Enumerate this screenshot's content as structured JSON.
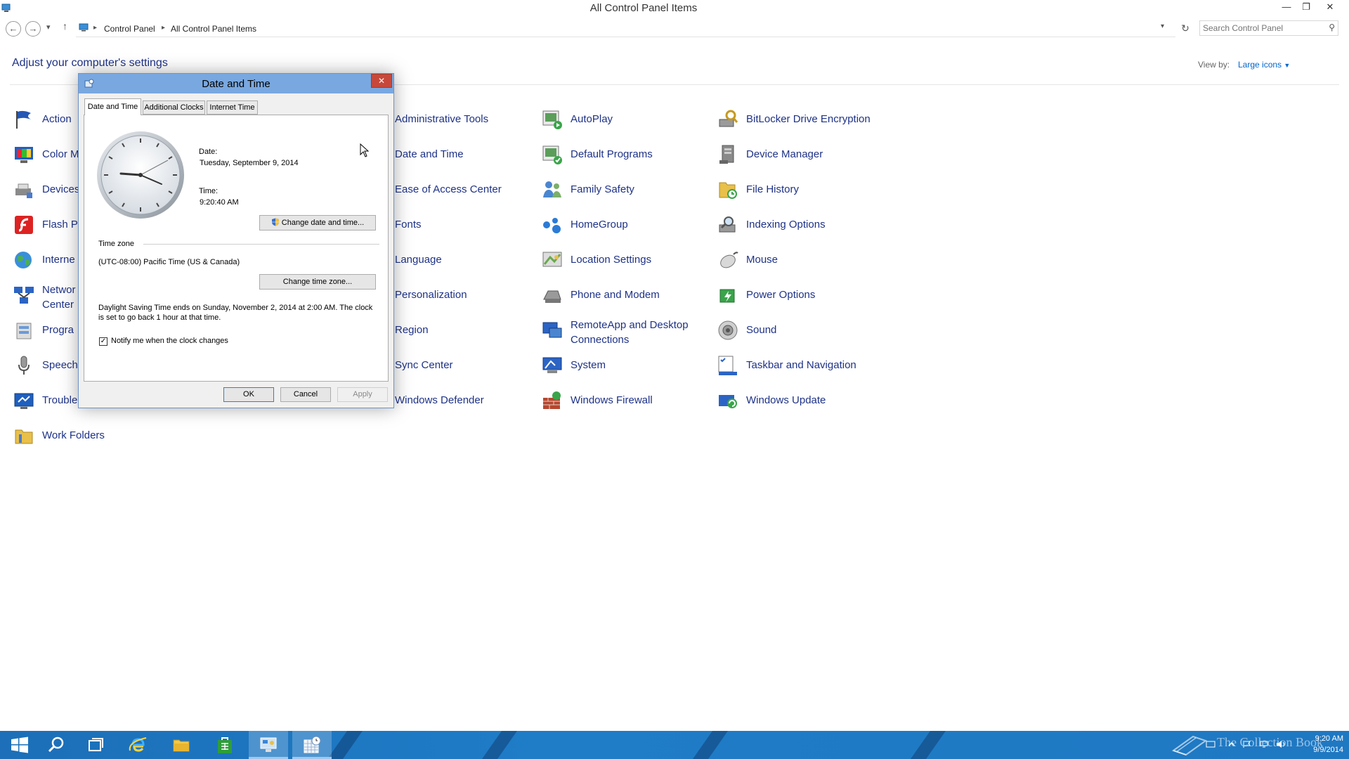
{
  "window": {
    "title": "All Control Panel Items"
  },
  "address": {
    "crumbs": [
      "Control Panel",
      "All Control Panel Items"
    ],
    "search_placeholder": "Search Control Panel"
  },
  "content": {
    "heading": "Adjust your computer's settings",
    "view_by_label": "View by:",
    "view_by_value": "Large icons"
  },
  "items": [
    {
      "label": "Action"
    },
    {
      "label": "Color M"
    },
    {
      "label": "Devices"
    },
    {
      "label": "Flash P"
    },
    {
      "label": "Interne"
    },
    {
      "label": "Networ Center"
    },
    {
      "label": "Progra"
    },
    {
      "label": "Speech"
    },
    {
      "label": "Trouble"
    },
    {
      "label": "Work Folders"
    },
    {
      "label": "Administrative Tools"
    },
    {
      "label": "Date and Time"
    },
    {
      "label": "Ease of Access Center"
    },
    {
      "label": "Fonts"
    },
    {
      "label": "Language"
    },
    {
      "label": "Personalization"
    },
    {
      "label": "Region"
    },
    {
      "label": "Sync Center"
    },
    {
      "label": "Windows Defender"
    },
    {
      "label": "AutoPlay"
    },
    {
      "label": "Default Programs"
    },
    {
      "label": "Family Safety"
    },
    {
      "label": "HomeGroup"
    },
    {
      "label": "Location Settings"
    },
    {
      "label": "Phone and Modem"
    },
    {
      "label": "RemoteApp and Desktop Connections"
    },
    {
      "label": "System"
    },
    {
      "label": "Windows Firewall"
    },
    {
      "label": "BitLocker Drive Encryption"
    },
    {
      "label": "Device Manager"
    },
    {
      "label": "File History"
    },
    {
      "label": "Indexing Options"
    },
    {
      "label": "Mouse"
    },
    {
      "label": "Power Options"
    },
    {
      "label": "Sound"
    },
    {
      "label": "Taskbar and Navigation"
    },
    {
      "label": "Windows Update"
    }
  ],
  "dialog": {
    "title": "Date and Time",
    "tabs": [
      "Date and Time",
      "Additional Clocks",
      "Internet Time"
    ],
    "date_label": "Date:",
    "date_value": "Tuesday, September 9, 2014",
    "time_label": "Time:",
    "time_value": "9:20:40 AM",
    "change_datetime_button": "Change date and time...",
    "timezone_header": "Time zone",
    "timezone_value": "(UTC-08:00) Pacific Time (US & Canada)",
    "change_timezone_button": "Change time zone...",
    "dst_note": "Daylight Saving Time ends on Sunday, November 2, 2014 at 2:00 AM. The clock is set to go back 1 hour at that time.",
    "notify_checkbox_label": "Notify me when the clock changes",
    "notify_checked": true,
    "ok_button": "OK",
    "cancel_button": "Cancel",
    "apply_button": "Apply"
  },
  "taskbar": {
    "watermark": "The Collection Book",
    "time": "9:20 AM",
    "date": "9/9/2014"
  },
  "colors": {
    "link": "#1e3287",
    "taskbar": "#1f7cc7",
    "dialog_title": "#79a8e0",
    "close_button": "#c7483a"
  }
}
